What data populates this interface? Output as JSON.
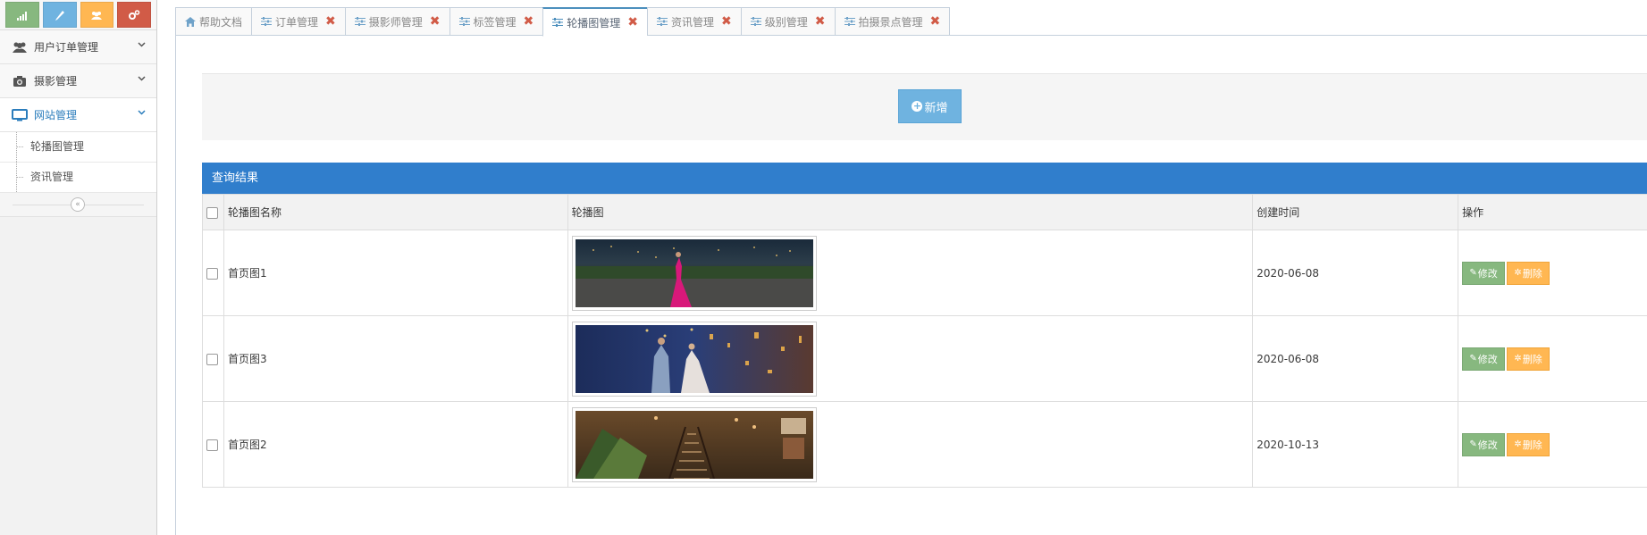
{
  "sidebar": {
    "shortcuts": [
      {
        "icon": "signal-icon",
        "color": "#87b87f"
      },
      {
        "icon": "pencil-icon",
        "color": "#6fb3e0"
      },
      {
        "icon": "users-icon",
        "color": "#ffb752"
      },
      {
        "icon": "cogs-icon",
        "color": "#d15b47"
      }
    ],
    "items": [
      {
        "label": "用户订单管理",
        "icon": "users-icon"
      },
      {
        "label": "摄影管理",
        "icon": "camera-icon"
      },
      {
        "label": "网站管理",
        "icon": "desktop-icon",
        "active": true
      }
    ],
    "sub_items": [
      {
        "label": "轮播图管理"
      },
      {
        "label": "资讯管理"
      }
    ]
  },
  "tabs": [
    {
      "label": "帮助文档",
      "icon": "home-icon",
      "closable": false
    },
    {
      "label": "订单管理",
      "icon": "sliders-icon",
      "closable": true
    },
    {
      "label": "摄影师管理",
      "icon": "sliders-icon",
      "closable": true
    },
    {
      "label": "标签管理",
      "icon": "sliders-icon",
      "closable": true
    },
    {
      "label": "轮播图管理",
      "icon": "sliders-icon",
      "closable": true,
      "active": true
    },
    {
      "label": "资讯管理",
      "icon": "sliders-icon",
      "closable": true
    },
    {
      "label": "级别管理",
      "icon": "sliders-icon",
      "closable": true
    },
    {
      "label": "拍摄景点管理",
      "icon": "sliders-icon",
      "closable": true
    }
  ],
  "toolbar": {
    "add_label": "新增"
  },
  "results": {
    "title": "查询结果",
    "columns": [
      "轮播图名称",
      "轮播图",
      "创建时间",
      "操作"
    ],
    "rows": [
      {
        "name": "首页图1",
        "image": "night-city-red-dress-photo",
        "created": "2020-06-08"
      },
      {
        "name": "首页图3",
        "image": "night-city-couple-photo",
        "created": "2020-06-08"
      },
      {
        "name": "首页图2",
        "image": "cafe-staircase-photo",
        "created": "2020-10-13"
      }
    ],
    "edit_label": "修改",
    "delete_label": "删除"
  },
  "colors": {
    "accent": "#307ecc",
    "edit": "#87b87f",
    "delete": "#ffb752",
    "add": "#6fb3e0",
    "close": "#d15b47"
  }
}
